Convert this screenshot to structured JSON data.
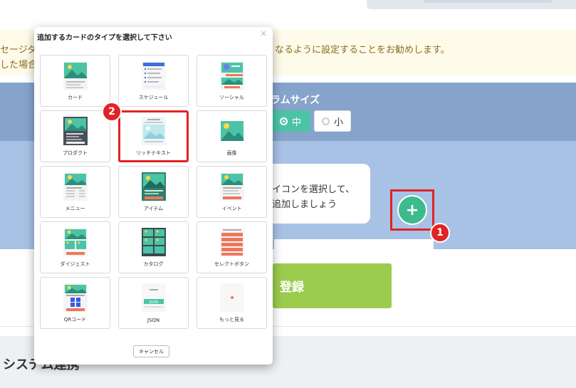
{
  "notice": {
    "line1_left": "セージダ",
    "line1_right": "なるように設定することをお勧めします。",
    "line2_left": "した場合"
  },
  "settings": {
    "column_size_label": "ラムサイズ",
    "option_medium": "中",
    "option_small": "小",
    "selected": "中"
  },
  "hint": {
    "line1": "イコンを選択して、",
    "line2": "追加しましょう"
  },
  "add_button": {
    "label": "+"
  },
  "register_button": {
    "label": "登録"
  },
  "footer": {
    "title": "システム連携"
  },
  "modal": {
    "title": "追加するカードのタイプを選択して下さい",
    "close": "×",
    "cancel": "キャンセル",
    "cards": [
      {
        "label": "カード",
        "icon": "card-icon"
      },
      {
        "label": "スケジュール",
        "icon": "schedule-icon"
      },
      {
        "label": "ソーシャル",
        "icon": "social-icon"
      },
      {
        "label": "プロダクト",
        "icon": "product-icon"
      },
      {
        "label": "リッチテキスト",
        "icon": "richtext-icon"
      },
      {
        "label": "画像",
        "icon": "image-icon"
      },
      {
        "label": "メニュー",
        "icon": "menu-icon"
      },
      {
        "label": "アイテム",
        "icon": "item-icon"
      },
      {
        "label": "イベント",
        "icon": "event-icon"
      },
      {
        "label": "ダイジェスト",
        "icon": "digest-icon"
      },
      {
        "label": "カタログ",
        "icon": "catalog-icon"
      },
      {
        "label": "セレクトボタン",
        "icon": "select-button-icon"
      },
      {
        "label": "QRコード",
        "icon": "qrcode-icon"
      },
      {
        "label": "JSON",
        "icon": "json-icon"
      },
      {
        "label": "もっと見る",
        "icon": "more-icon"
      }
    ]
  },
  "annotations": {
    "step1": "1",
    "step2": "2"
  },
  "colors": {
    "teal": "#4cc3a6",
    "green": "#3dbb8f",
    "highlight_red": "#e02424",
    "register_green": "#9ccc4e",
    "band_dark": "#86a4cb",
    "band_light": "#a8c2e5"
  }
}
